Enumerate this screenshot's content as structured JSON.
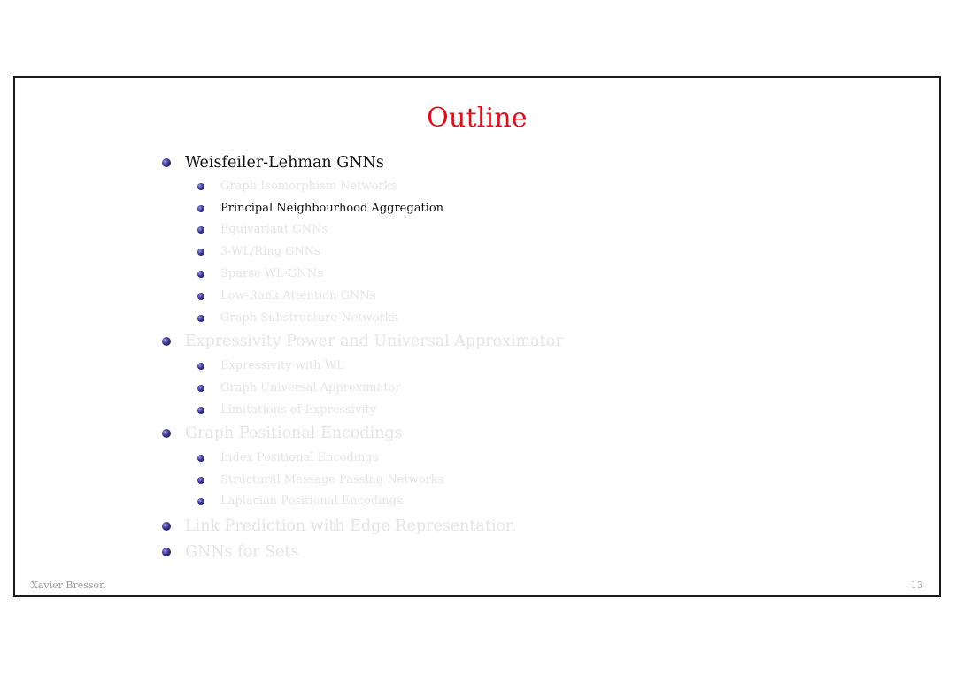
{
  "slide": {
    "title": "Outline",
    "title_color": "#d0161c",
    "bullet_icon": "sphere-bullet-icon",
    "outline": [
      {
        "level": 1,
        "label": "Weisfeiler-Lehman GNNs",
        "active": true
      },
      {
        "level": 2,
        "label": "Graph Isomorphism Networks",
        "active": false
      },
      {
        "level": 2,
        "label": "Principal Neighbourhood Aggregation",
        "active": true
      },
      {
        "level": 2,
        "label": "Equivariant GNNs",
        "active": false
      },
      {
        "level": 2,
        "label": "3-WL/Ring GNNs",
        "active": false
      },
      {
        "level": 2,
        "label": "Sparse WL-GNNs",
        "active": false
      },
      {
        "level": 2,
        "label": "Low-Rank Attention GNNs",
        "active": false
      },
      {
        "level": 2,
        "label": "Graph Substructure Networks",
        "active": false
      },
      {
        "level": 1,
        "label": "Expressivity Power and Universal Approximator",
        "active": false
      },
      {
        "level": 2,
        "label": "Expressivity with WL",
        "active": false
      },
      {
        "level": 2,
        "label": "Graph Universal Approximator",
        "active": false
      },
      {
        "level": 2,
        "label": "Limitations of Expressivity",
        "active": false
      },
      {
        "level": 1,
        "label": "Graph Positional Encodings",
        "active": false
      },
      {
        "level": 2,
        "label": "Index Positional Encodings",
        "active": false
      },
      {
        "level": 2,
        "label": "Structural Message Passing Networks",
        "active": false
      },
      {
        "level": 2,
        "label": "Laplacian Positional Encodings",
        "active": false
      },
      {
        "level": 1,
        "label": "Link Prediction with Edge Representation",
        "active": false
      },
      {
        "level": 1,
        "label": "GNNs for Sets",
        "active": false
      }
    ],
    "footer": {
      "author": "Xavier Bresson",
      "page_number": "13"
    }
  }
}
